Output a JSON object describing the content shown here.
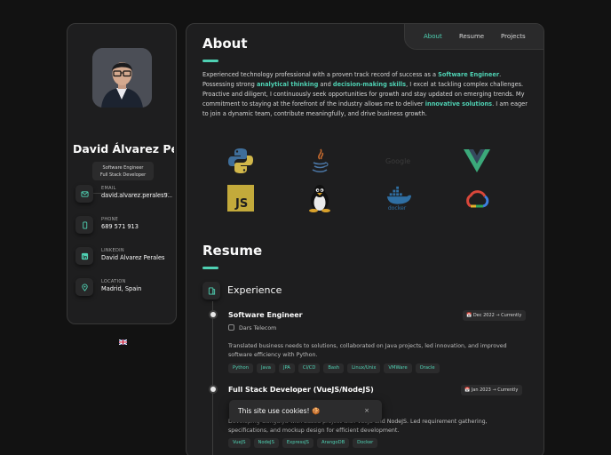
{
  "profile": {
    "name": "David Álvarez Pe...",
    "title_line1": "Software Engineer",
    "title_line2": "Full Stack Developer",
    "contacts": [
      {
        "label": "EMAIL",
        "value": "david.alvarez.perales9...",
        "icon": "mail-icon"
      },
      {
        "label": "PHONE",
        "value": "689 571 913",
        "icon": "phone-icon"
      },
      {
        "label": "LINKEDIN",
        "value": "David Álvarez Perales",
        "icon": "linkedin-icon"
      },
      {
        "label": "LOCATION",
        "value": "Madrid, Spain",
        "icon": "location-pin-icon"
      }
    ],
    "flag": "uk-flag-icon"
  },
  "nav": {
    "items": [
      "About",
      "Resume",
      "Projects"
    ],
    "active": "About"
  },
  "about": {
    "heading": "About",
    "p1": "Experienced technology professional with a proven track record of success as a ",
    "h1": "Software Engineer",
    "p2": ". Possessing strong ",
    "h2": "analytical thinking",
    "p3": " and ",
    "h3": "decision-making skills",
    "p4": ", I excel at tackling complex challenges. Proactive and diligent, I continuously seek opportunities for growth and stay updated on emerging trends. My commitment to staying at the forefront of the industry allows me to deliver ",
    "h4": "innovative solutions",
    "p5": ". I am eager to join a dynamic team, contribute meaningfully, and drive business growth."
  },
  "tech_logos": [
    "python-icon",
    "java-icon",
    "google-icon",
    "vue-icon",
    "javascript-icon",
    "linux-tux-icon",
    "docker-icon",
    "google-cloud-icon"
  ],
  "tech_labels": {
    "js": "JS",
    "docker": "docker",
    "google": "Google"
  },
  "resume": {
    "heading": "Resume",
    "section": "Experience",
    "jobs": [
      {
        "title": "Software Engineer",
        "date": "Dec 2022 → Currently",
        "company": "Dars Telecom",
        "desc": "Translated business needs to solutions, collaborated on Java projects, led innovation, and improved software efficiency with Python.",
        "tags": [
          "Python",
          "Java",
          "JPA",
          "CI/CD",
          "Bash",
          "Linux/Unix",
          "VMWare",
          "Oracle"
        ]
      },
      {
        "title": "Full Stack Developer (VueJS/NodeJS)",
        "date": "Jan 2023 → Currently",
        "desc": "Developing Gangulya with based project with VueJS and NodeJS. Led requirement gathering, specifications, and mockup design for efficient development.",
        "tags": [
          "VueJS",
          "NodeJS",
          "ExpressJS",
          "ArangoDB",
          "Docker"
        ]
      }
    ]
  },
  "cookie": {
    "text": "This site use cookies! 🍪",
    "close": "×"
  },
  "colors": {
    "accent": "#4fd1b3",
    "card": "#1e1e1f",
    "bg": "#121212"
  }
}
